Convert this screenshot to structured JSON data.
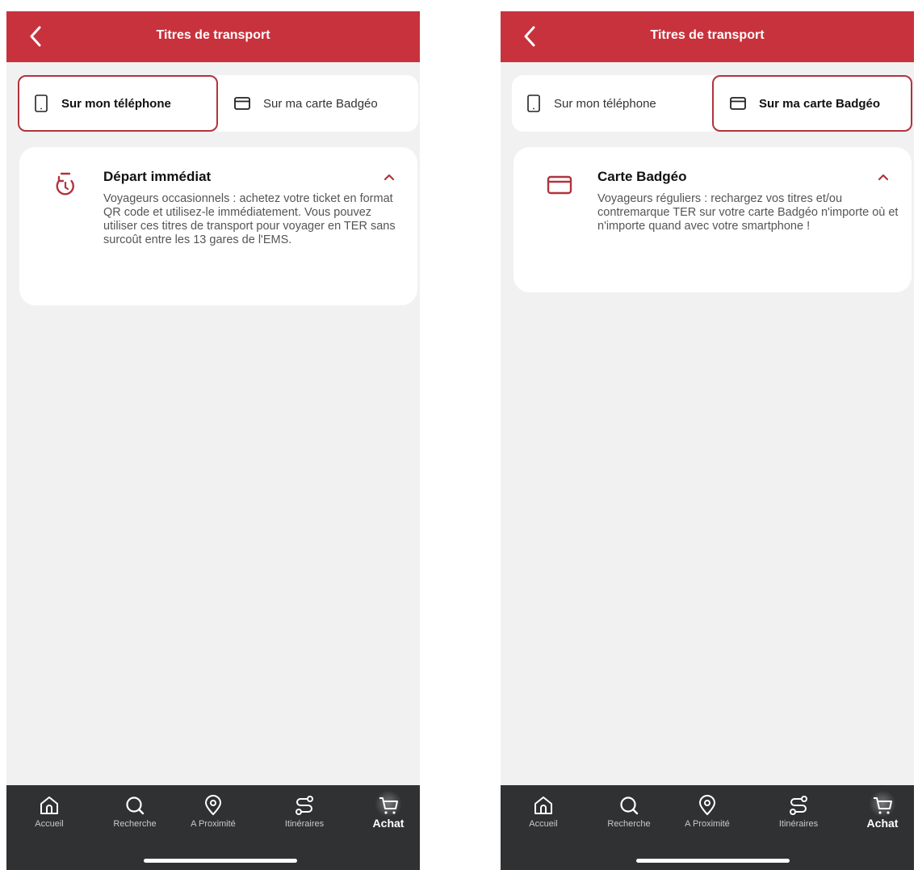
{
  "left": {
    "header": {
      "title": "Titres de transport"
    },
    "tabs": [
      {
        "label": "Sur mon téléphone",
        "active": true,
        "icon": "phone-icon"
      },
      {
        "label": "Sur ma carte Badgéo",
        "active": false,
        "icon": "card-icon"
      }
    ],
    "card": {
      "icon": "timer-icon",
      "title": "Départ immédiat",
      "text": "Voyageurs occasionnels : achetez votre ticket en format QR code et utilisez-le immédiatement. Vous pouvez utiliser ces titres de transport pour voyager en TER sans surcoût entre les 13 gares de l'EMS."
    }
  },
  "right": {
    "header": {
      "title": "Titres de transport"
    },
    "tabs": [
      {
        "label": "Sur mon téléphone",
        "active": false,
        "icon": "phone-icon"
      },
      {
        "label": "Sur ma carte Badgéo",
        "active": true,
        "icon": "card-icon"
      }
    ],
    "card": {
      "icon": "card-icon",
      "title": "Carte Badgéo",
      "text": "Voyageurs réguliers : rechargez vos titres et/ou contremarque TER sur votre carte Badgéo n'importe où et n'importe quand avec votre smartphone !"
    }
  },
  "nav": [
    {
      "label": "Accueil",
      "icon": "home-icon"
    },
    {
      "label": "Recherche",
      "icon": "search-icon"
    },
    {
      "label": "A Proximité",
      "icon": "location-pin-icon"
    },
    {
      "label": "Itinéraires",
      "icon": "route-icon"
    },
    {
      "label": "Achat",
      "icon": "cart-icon",
      "active": true
    }
  ],
  "colors": {
    "brand_red": "#c8323c",
    "nav_bg": "#2f3133",
    "page_bg": "#f1f1f1"
  }
}
